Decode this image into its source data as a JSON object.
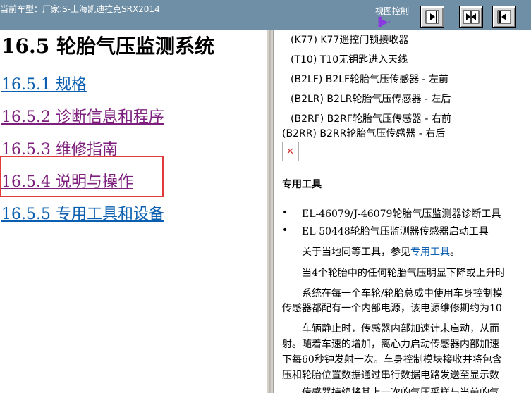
{
  "topbar": {
    "vehicle_label": "当前车型：厂家:S-上海凯迪拉克SRX2014",
    "view_control_label": "视图控制",
    "view_control_glyph": "▐▶·",
    "buttons": [
      {
        "name": "expand-right",
        "icon": "arrow-right-icon"
      },
      {
        "name": "split-center",
        "icon": "split-arrows-icon"
      },
      {
        "name": "expand-left",
        "icon": "arrow-left-icon"
      }
    ]
  },
  "left": {
    "title": "16.5 轮胎气压监测系统",
    "toc": [
      {
        "label": "16.5.1 规格",
        "color": "#0b5fb0"
      },
      {
        "label": "16.5.2 诊断信息和程序",
        "color": "#7d1f7d"
      },
      {
        "label": "16.5.3 维修指南",
        "color": "#7d1f7d"
      },
      {
        "label": "16.5.4 说明与操作",
        "color": "#7d1f7d"
      },
      {
        "label": "16.5.5 专用工具和设备",
        "color": "#0b5fb0"
      }
    ]
  },
  "right": {
    "components": [
      "(K77) K77遥控门锁接收器",
      "(T10) T10无钥匙进入天线",
      "(B2LF) B2LF轮胎气压传感器 - 左前",
      "(B2LR) B2LR轮胎气压传感器 - 左后",
      "(B2RF) B2RF轮胎气压传感器 - 右前",
      "(B2RR) B2RR轮胎气压传感器 - 右后"
    ],
    "tools_heading": "专用工具",
    "tools": [
      "EL-46079/J-46079轮胎气压监测器诊断工具",
      "EL-50448轮胎气压监测器传感器启动工具"
    ],
    "equiv_prefix": "关于当地同等工具，参见",
    "equiv_link": "专用工具",
    "equiv_suffix": "。",
    "para1": "当4个轮胎中的任何轮胎气压明显下降或上升时",
    "para2_l1": "系统在每一个车轮/轮胎总成中使用车身控制模",
    "para2_l2": "传感器都配有一个内部电源，该电源维修期约为10",
    "para3_l1": "车辆静止时，传感器内部加速计未启动，从而",
    "para3_l2": "射。随着车速的增加，离心力启动传感器内部加速",
    "para3_l3": "下每60秒钟发射一次。车身控制模块接收并将包含",
    "para3_l4": "压和轮胎位置数据通过串行数据电路发送至显示数",
    "para4_l1": "传感器持续将其上一次的气压采样与当前的气"
  }
}
